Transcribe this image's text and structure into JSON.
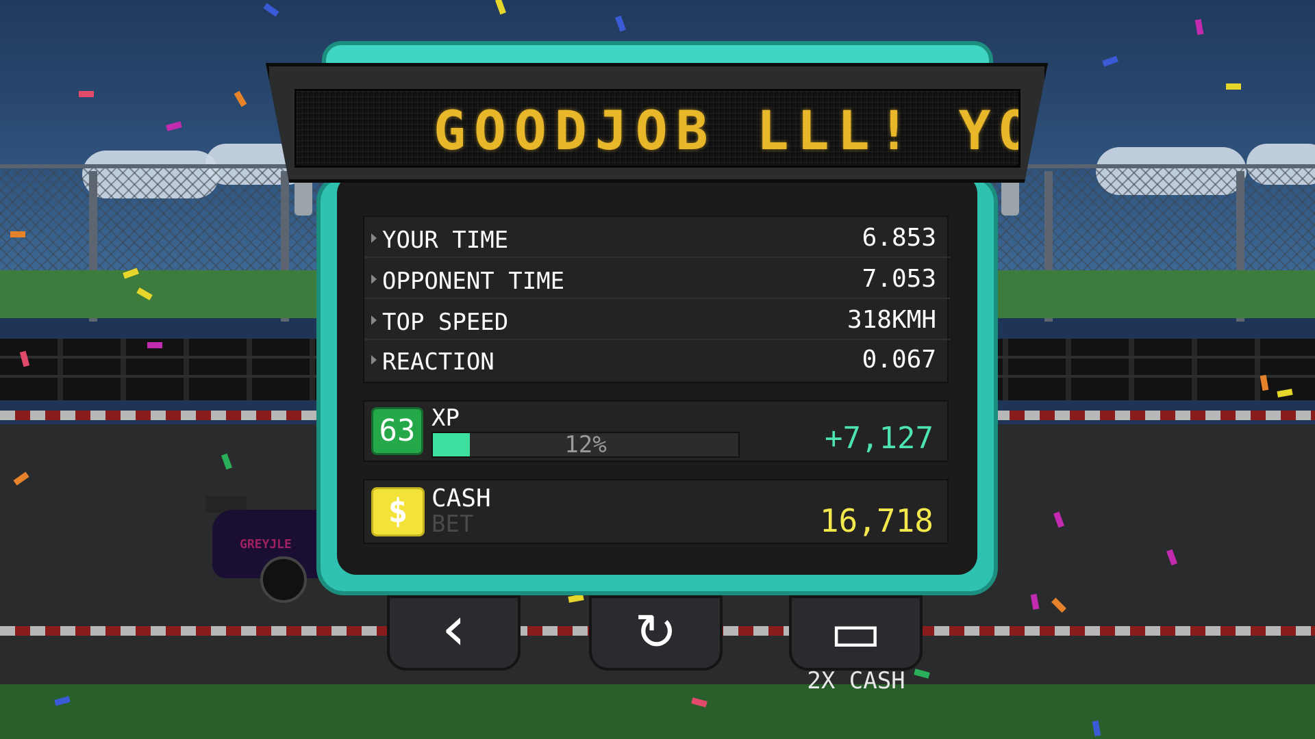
{
  "marquee": {
    "text": "GOODJOB LLL! YOU WON"
  },
  "stats": [
    {
      "label": "YOUR TIME",
      "value": "6.853"
    },
    {
      "label": "OPPONENT TIME",
      "value": "7.053"
    },
    {
      "label": "TOP SPEED",
      "value": "318KMH"
    },
    {
      "label": "REACTION",
      "value": "0.067"
    }
  ],
  "xp": {
    "level": "63",
    "label": "XP",
    "percent_text": "12%",
    "progress": 0.12,
    "gain": "+7,127",
    "bar_color": "#3ee0a0"
  },
  "cash": {
    "label": "CASH",
    "sublabel": "BET",
    "value": "16,718",
    "icon": "dollar-icon"
  },
  "buttons": [
    {
      "name": "back-button",
      "icon": "chevron-left-icon",
      "glyph": "‹"
    },
    {
      "name": "restart-button",
      "icon": "restart-icon",
      "glyph": "↻"
    },
    {
      "name": "video-button",
      "icon": "video-camera-icon",
      "glyph": "▭",
      "caption": "2X CASH"
    }
  ],
  "car": {
    "livery_text": "GREYJLE"
  },
  "colors": {
    "accent": "#2fc2b0",
    "marquee_text": "#e8b72a",
    "xp_gain": "#4de3b2",
    "cash_value": "#f3e84c"
  }
}
